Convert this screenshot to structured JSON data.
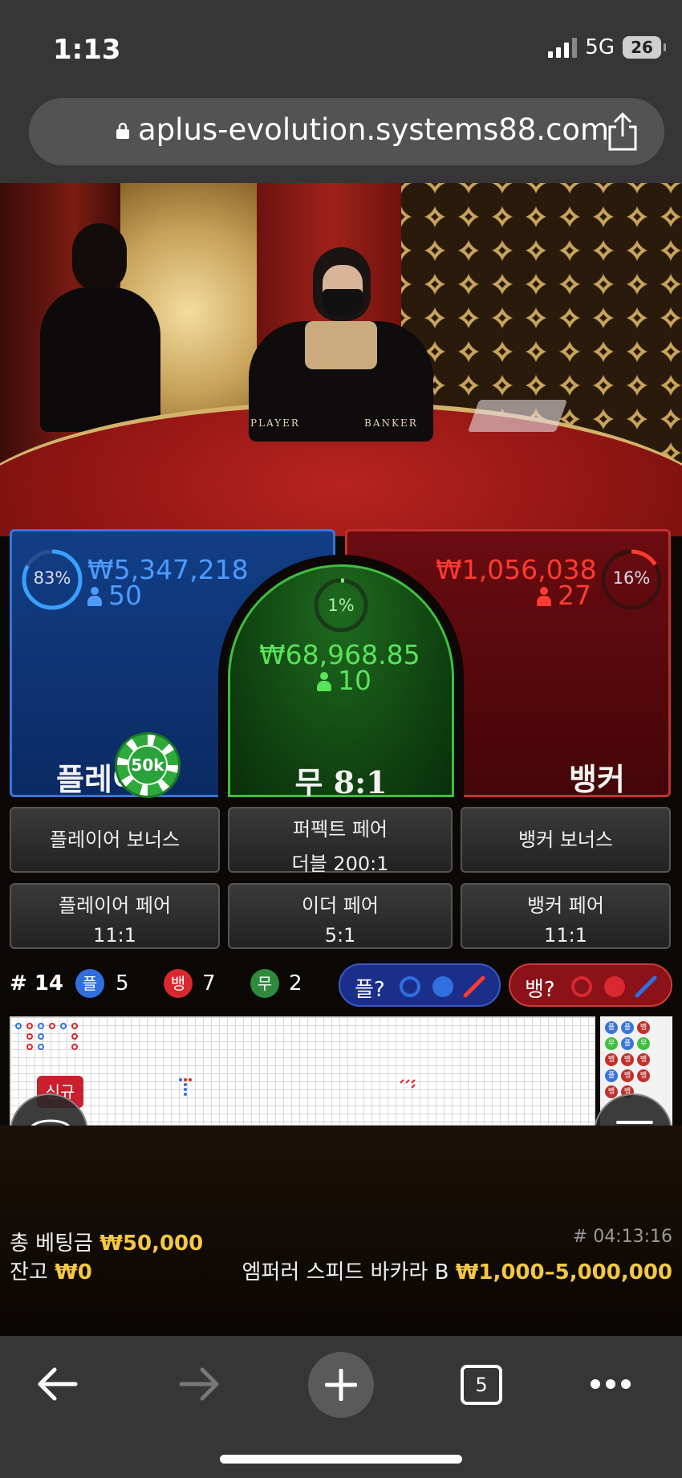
{
  "status_bar": {
    "time": "1:13",
    "network": "5G",
    "battery": "26"
  },
  "browser": {
    "url": "aplus-evolution.systems88.com",
    "tab_count": "5"
  },
  "video": {
    "table_player": "PLAYER",
    "table_banker": "BANKER"
  },
  "bets": {
    "player": {
      "pct": "83%",
      "pct_value": 0.83,
      "amount": "₩5,347,218",
      "players": "50",
      "label": "플레이어"
    },
    "tie": {
      "pct": "1%",
      "pct_value": 0.01,
      "amount": "₩68,968.85",
      "players": "10",
      "label": "무 8:1"
    },
    "banker": {
      "pct": "16%",
      "pct_value": 0.16,
      "amount": "₩1,056,038",
      "players": "27",
      "label": "뱅커"
    },
    "chip": "50k"
  },
  "side_bets": {
    "player_bonus": "플레이어 보너스",
    "perfect_pair_l1": "퍼펙트 페어",
    "perfect_pair_l2": "더블 200:1",
    "banker_bonus": "뱅커 보너스",
    "player_pair_l1": "플레이어 페어",
    "player_pair_l2": "11:1",
    "either_pair_l1": "이더 페어",
    "either_pair_l2": "5:1",
    "banker_pair_l1": "뱅커 페어",
    "banker_pair_l2": "11:1"
  },
  "stats": {
    "round": "# 14",
    "player_badge": "플",
    "player_count": "5",
    "banker_badge": "뱅",
    "banker_count": "7",
    "tie_badge": "무",
    "tie_count": "2",
    "player_predict": "플?",
    "banker_predict": "뱅?"
  },
  "road": {
    "new_label": "신규"
  },
  "bead_road": [
    "플",
    "플",
    "뱅",
    "무",
    "플",
    "무",
    "뱅",
    "뱅",
    "뱅",
    "플",
    "뱅",
    "뱅",
    "뱅",
    "뱅"
  ],
  "info": {
    "total_bet_label": "총 베팅금",
    "total_bet": "₩50,000",
    "balance_label": "잔고",
    "balance": "₩0",
    "game_id": "# 04:13:16",
    "table_name": "엠퍼러 스피드 바카라 B",
    "limits": "₩1,000–5,000,000"
  },
  "colors": {
    "player": "#3a74d9",
    "banker": "#c0312d",
    "tie": "#3fbf3f",
    "gold": "#f5c842"
  }
}
